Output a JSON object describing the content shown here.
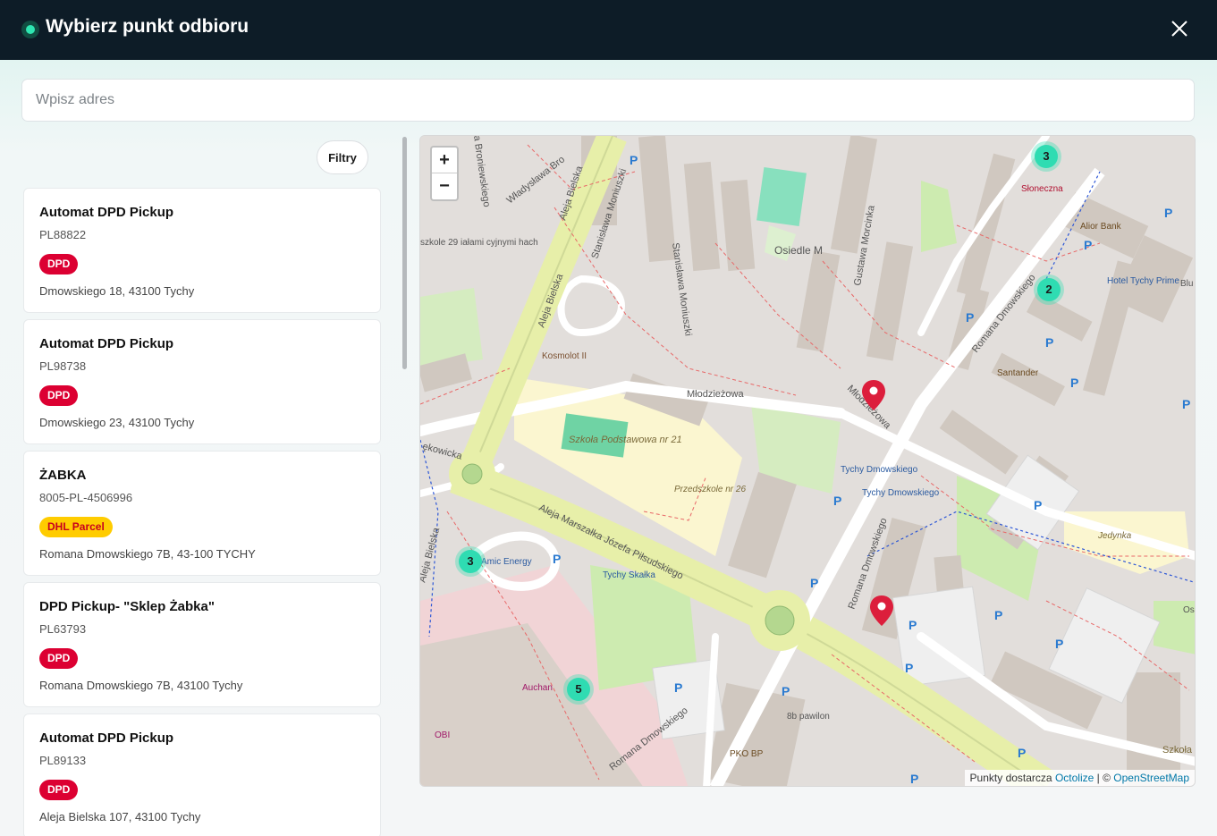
{
  "header": {
    "title": "Wybierz punkt odbioru"
  },
  "search": {
    "placeholder": "Wpisz adres"
  },
  "filter": {
    "label": "Filtry"
  },
  "points": [
    {
      "name": "Automat DPD Pickup",
      "code": "PL88822",
      "badge": "DPD",
      "address": "Dmowskiego 18, 43100 Tychy"
    },
    {
      "name": "Automat DPD Pickup",
      "code": "PL98738",
      "badge": "DPD",
      "address": "Dmowskiego 23, 43100 Tychy"
    },
    {
      "name": "ŻABKA",
      "code": "8005-PL-4506996",
      "badge": "DHL Parcel",
      "address": "Romana Dmowskiego 7B, 43-100 TYCHY"
    },
    {
      "name": "DPD Pickup- \"Sklep Żabka\"",
      "code": "PL63793",
      "badge": "DPD",
      "address": "Romana Dmowskiego 7B, 43100 Tychy"
    },
    {
      "name": "Automat DPD Pickup",
      "code": "PL89133",
      "badge": "DPD",
      "address": "Aleja Bielska 107, 43100 Tychy"
    }
  ],
  "badge_colors": {
    "DPD": "#dc0032",
    "DHL Parcel": "#ffcc00"
  },
  "map": {
    "zoom_in": "+",
    "zoom_out": "−",
    "attribution": {
      "prefix": "Punkty dostarcza",
      "provider": "Octolize",
      "separator": "| ©",
      "osm": "OpenStreetMap"
    },
    "clusters": [
      "3",
      "2",
      "3",
      "5"
    ],
    "labels": {
      "aleja_bielska_1": "Aleja Bielska",
      "aleja_bielska_2": "Aleja Bielska",
      "aleja_bielska_3": "Aleja Bielska",
      "pilsudskiego": "Aleja Marszałka Józefa Piłsudskiego",
      "mlodziezowa_1": "Młodzieżowa",
      "mlodziezowa_2": "Młodzieżowa",
      "dmowskiego_1": "Romana Dmowskiego",
      "dmowskiego_2": "Romana Dmowskiego",
      "dmowskiego_3": "Romana Dmowskiego",
      "moniuszki_1": "Stanisława Moniuszki",
      "moniuszki_2": "Stanisława Moniuszki",
      "morcinka": "Gustawa Morcinka",
      "osiedle": "Osiedle M",
      "szkola_1": "Szkoła Podstawowa nr 21",
      "przedszkole": "Przedszkole nr 26",
      "kosmolot": "Kosmolot II",
      "sloneczna": "Słoneczna",
      "alior": "Alior Bank",
      "hotel": "Hotel Tychy Prime",
      "santander": "Santander",
      "tychy_dmowskiego_1": "Tychy Dmowskiego",
      "tychy_dmowskiego_2": "Tychy Dmowskiego",
      "tychy_skalka": "Tychy Skałka",
      "amic": "Amic Energy",
      "auchan": "Auchan",
      "obi": "OBI",
      "pko": "PKO BP",
      "pawilon": "8b pawilon",
      "jedynka": "Jedynka",
      "szkola_2": "Szkoła Podstawowa",
      "wladyslawa": "Władysława Bro",
      "broniewskiego": "a Broniewskiego",
      "kowicka": "ękowicka",
      "szkole": "szkole 29 iałami cyjnymi hach",
      "blu": "Blu",
      "osi": "Osi"
    }
  }
}
